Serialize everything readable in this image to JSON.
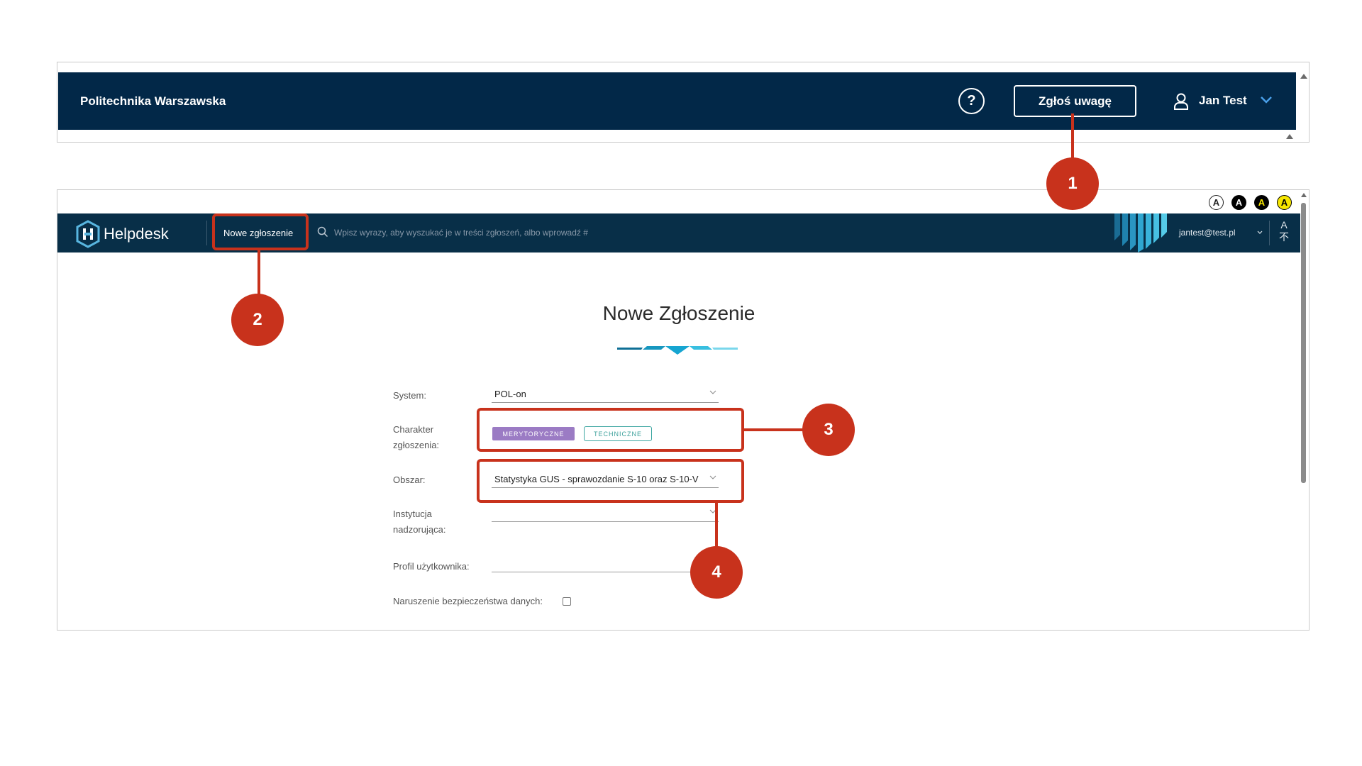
{
  "top_app": {
    "brand": "Politechnika Warszawska",
    "help_label": "?",
    "report_button": "Zgłoś uwagę",
    "user_name": "Jan Test"
  },
  "accessibility": [
    "A",
    "A",
    "A",
    "A"
  ],
  "helpdesk": {
    "title": "Helpdesk",
    "new_ticket": "Nowe zgłoszenie",
    "search_placeholder": "Wpisz wyrazy, aby wyszukać je w treści zgłoszeń, albo wprowadź #",
    "user_email": "jantest@test.pl",
    "lang_top": "A",
    "lang_bottom": "不"
  },
  "form": {
    "title": "Nowe Zgłoszenie",
    "system_label": "System:",
    "system_value": "POL-on",
    "charakter_label_1": "Charakter",
    "charakter_label_2": "zgłoszenia:",
    "tag_merytoryczne": "MERYTORYCZNE",
    "tag_techniczne": "TECHNICZNE",
    "obszar_label": "Obszar:",
    "obszar_value": "Statystyka GUS - sprawozdanie S-10 oraz S-10-V",
    "instytucja_label_1": "Instytucja",
    "instytucja_label_2": "nadzorująca:",
    "profil_label": "Profil użytkownika:",
    "naruszenie_label": "Naruszenie bezpieczeństwa danych:"
  },
  "callouts": [
    "1",
    "2",
    "3",
    "4"
  ],
  "colors": {
    "navy": "#022848",
    "helpdesk_bar": "#082f48",
    "callout_red": "#c8321c",
    "tag_purple": "#9b7bc4",
    "tag_teal": "#3aa5a0"
  }
}
